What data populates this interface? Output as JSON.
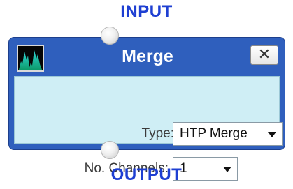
{
  "labels": {
    "input": "INPUT",
    "output": "OUTPUT"
  },
  "node": {
    "title": "Merge",
    "icon": "waveform-thumbnail-icon",
    "close_label": "✕",
    "fields": {
      "type": {
        "label": "Type:",
        "value": "HTP Merge"
      },
      "channels": {
        "label": "No. Channels:",
        "value": "1"
      }
    }
  },
  "colors": {
    "port_label": "#1e3fd2",
    "node_header": "#2f5fbd",
    "node_body": "#cfeef5"
  }
}
